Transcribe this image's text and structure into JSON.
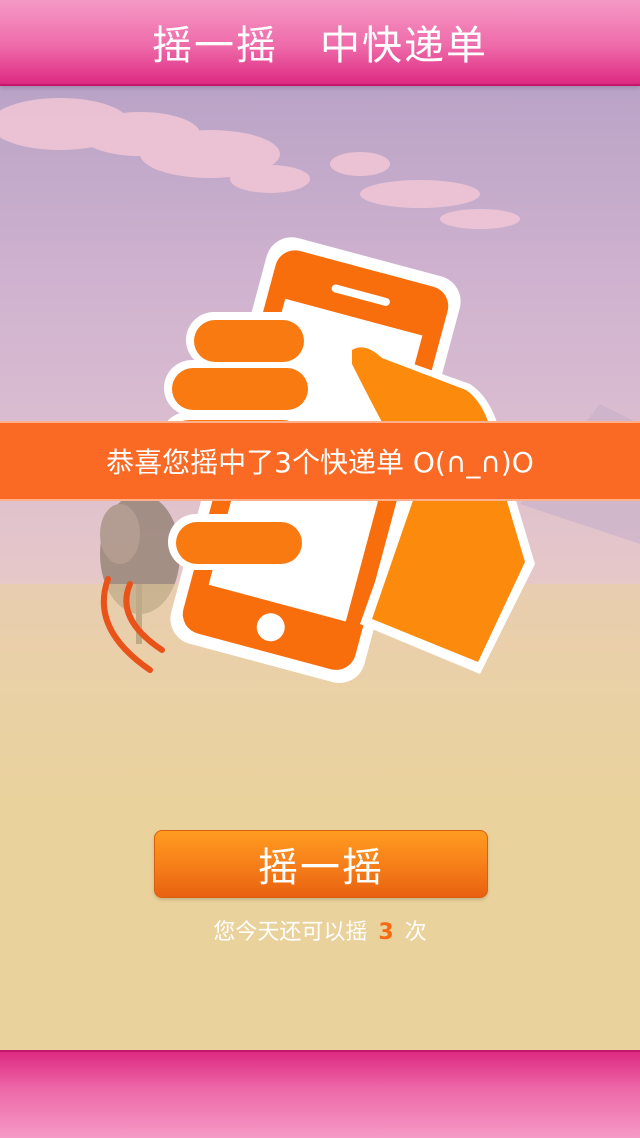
{
  "header": {
    "title": "摇一摇　中快递单"
  },
  "banner": {
    "message": "恭喜您摇中了3个快递单 O(∩_∩)O"
  },
  "shake_button": {
    "label": "摇一摇"
  },
  "remaining": {
    "prefix": "您今天还可以摇",
    "count": "3",
    "suffix": "次"
  },
  "colors": {
    "header": "#ee6aa9",
    "banner": "#fb6a25",
    "button": "#f7801a",
    "count": "#f56a12"
  },
  "icons": {
    "illustration": "hand-shaking-phone-icon"
  }
}
